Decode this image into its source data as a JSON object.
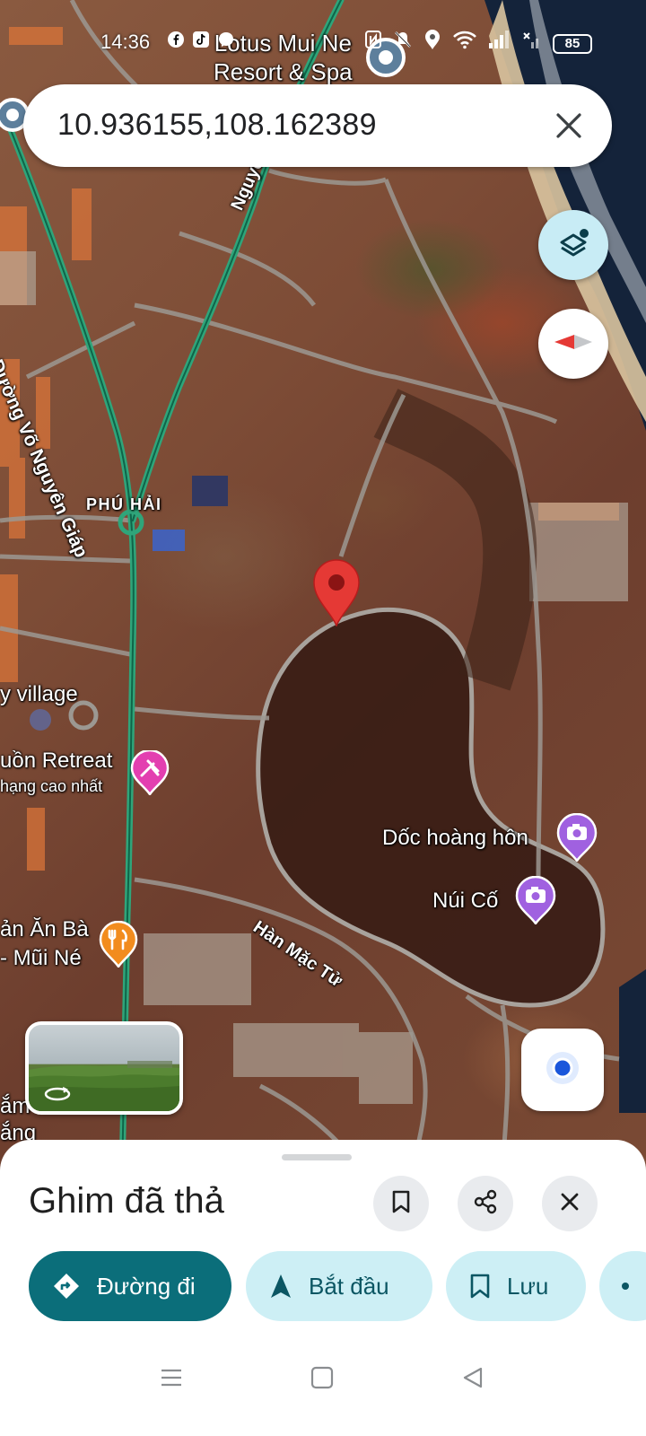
{
  "status_bar": {
    "time": "14:36",
    "battery": "85"
  },
  "search": {
    "query": "10.936155,108.162389"
  },
  "map": {
    "labels": {
      "resort_line1": "Lotus Mui Ne",
      "resort_line2": "Resort & Spa",
      "road_vo_nguyen_giap": "Đường Võ Nguyên Giáp",
      "road_nguyen": "Nguyễn",
      "phu_hai": "PHÚ HẢI",
      "village": "y village",
      "retreat": "uồn Retreat",
      "retreat_sub": "hạng cao nhất",
      "doc_hoang_hon": "Dốc hoàng hôn",
      "nui_co": "Núi Cố",
      "han_mac_tu": "Hàn Mặc Tử",
      "restaurant_line1": "ản Ăn Bà",
      "restaurant_line2": "- Mũi Né",
      "bottom_line1": "ắm",
      "bottom_line2": "ắng"
    },
    "colors": {
      "road_green": "#2fa57a",
      "pin_red": "#e53935",
      "poi_pink": "#e33fb0",
      "poi_purple": "#a061e0",
      "poi_orange": "#f28c1e",
      "water": "#152033"
    }
  },
  "sheet": {
    "title": "Ghim đã thả",
    "directions": "Đường đi",
    "start": "Bắt đầu",
    "save": "Lưu"
  },
  "icons": [
    "search-close-icon",
    "layers-icon",
    "compass-icon",
    "my-location-icon",
    "bookmark-icon",
    "share-icon",
    "close-icon",
    "directions-icon",
    "navigation-arrow-icon",
    "save-icon",
    "menu-icon",
    "home-icon",
    "back-icon"
  ]
}
